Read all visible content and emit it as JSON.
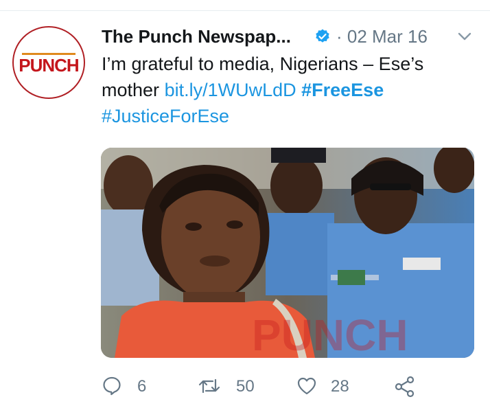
{
  "account": {
    "display_name": "The Punch Newspap...",
    "avatar_logo_text": "PUNCH"
  },
  "tweet": {
    "date": "· 02 Mar 16",
    "text_line1": "I’m grateful to media, Nigerians – Ese’s",
    "text_mother": "mother",
    "link": "bit.ly/1WUwLdD",
    "hashtag_1": "#FreeEse",
    "hashtag_2": "#JusticeForEse"
  },
  "photo": {
    "watermark": "PUNCH"
  },
  "actions": {
    "reply_count": "6",
    "retweet_count": "50",
    "like_count": "28"
  },
  "colors": {
    "link": "#1b95e0",
    "muted": "#657786",
    "brand_red": "#c4161c"
  },
  "icons": [
    "verified-badge-icon",
    "chevron-down-icon",
    "reply-icon",
    "retweet-icon",
    "like-icon",
    "share-icon"
  ]
}
